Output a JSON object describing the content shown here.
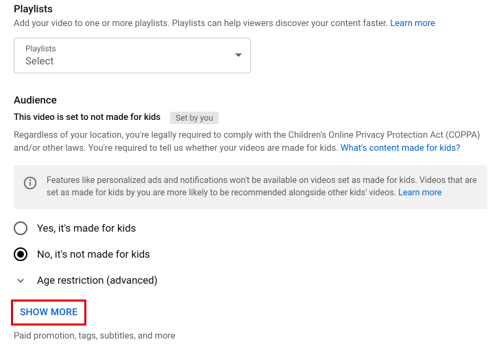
{
  "playlists": {
    "title": "Playlists",
    "desc": "Add your video to one or more playlists. Playlists can help viewers discover your content faster. ",
    "learn_more": "Learn more",
    "dropdown_label": "Playlists",
    "dropdown_value": "Select"
  },
  "audience": {
    "title": "Audience",
    "status_text": "This video is set to not made for kids",
    "badge": "Set by you",
    "legal_text": "Regardless of your location, you're legally required to comply with the Children's Online Privacy Protection Act (COPPA) and/or other laws. You're required to tell us whether your videos are made for kids. ",
    "legal_link": "What's content made for kids?",
    "info_text": "Features like personalized ads and notifications won't be available on videos set as made for kids. Videos that are set as made for kids by you are more likely to be recommended alongside other kids' videos. ",
    "info_link": "Learn more",
    "radio_yes": "Yes, it's made for kids",
    "radio_no": "No, it's not made for kids",
    "age_restriction": "Age restriction (advanced)"
  },
  "show_more": {
    "label": "Show more",
    "desc": "Paid promotion, tags, subtitles, and more"
  }
}
